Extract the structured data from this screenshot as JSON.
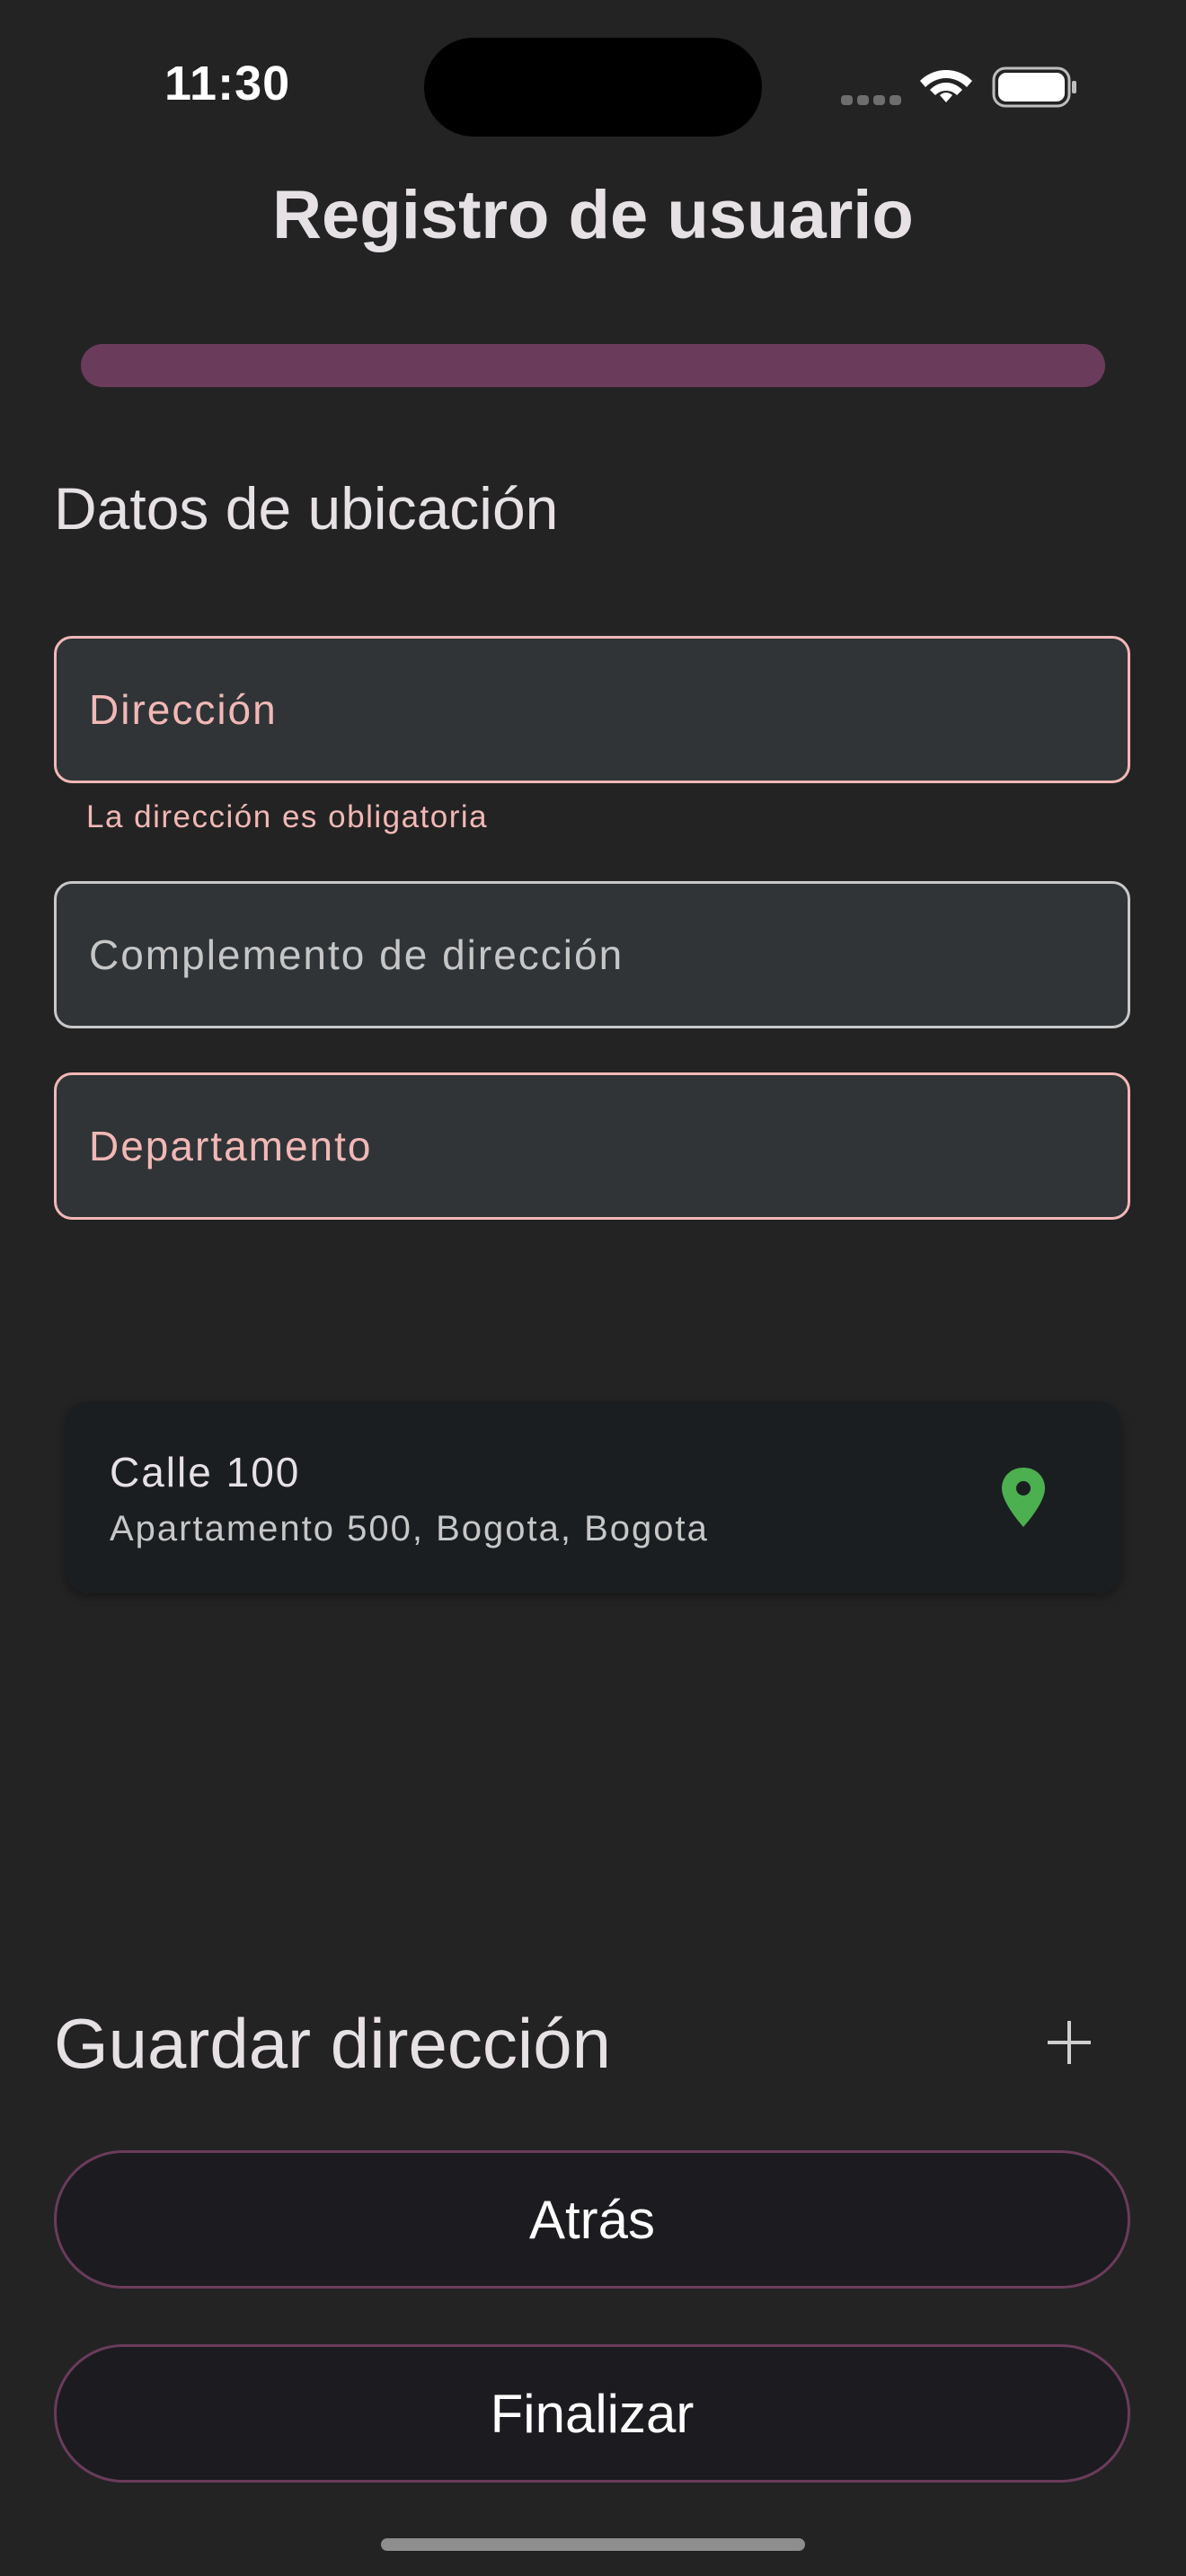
{
  "status_bar": {
    "time": "11:30"
  },
  "header": {
    "title": "Registro de usuario",
    "progress": 1.0
  },
  "form": {
    "section_title": "Datos de ubicación",
    "address": {
      "label": "Dirección",
      "error": "La dirección es obligatoria"
    },
    "address_complement": {
      "label": "Complemento de dirección"
    },
    "department": {
      "label": "Departamento"
    }
  },
  "address_card": {
    "line1": "Calle 100",
    "line2": "Apartamento 500, Bogota, Bogota",
    "icon": "location-pin-icon",
    "icon_color": "#4caf50"
  },
  "save_address": {
    "label": "Guardar dirección",
    "icon": "plus-icon"
  },
  "buttons": {
    "back": "Atrás",
    "finish": "Finalizar"
  },
  "colors": {
    "background": "#232323",
    "accent": "#6b3b5c",
    "error": "#f2b8b5",
    "field_bg": "#303437"
  }
}
